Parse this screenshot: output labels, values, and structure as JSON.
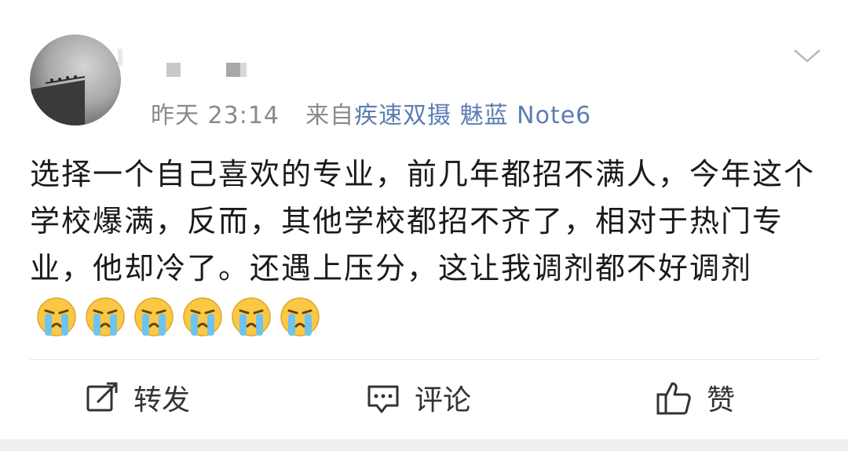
{
  "post": {
    "meta": {
      "time": "昨天 23:14",
      "from_label": "来自",
      "source": "疾速双摄 魅蓝 Note6"
    },
    "text": "选择一个自己喜欢的专业，前几年都招不满人，今年这个学校爆满，反而，其他学校都招不齐了，相对于热门专业，他却冷了。还遇上压分，这让我调剂都不好调剂",
    "emoji_count": 6,
    "emoji_name": "crying-face-icon"
  },
  "actions": {
    "repost_label": "转发",
    "comment_label": "评论",
    "like_label": "赞"
  },
  "colors": {
    "meta": "#8a8a8a",
    "source_link": "#5b7db1",
    "text": "#1a1a1a"
  }
}
